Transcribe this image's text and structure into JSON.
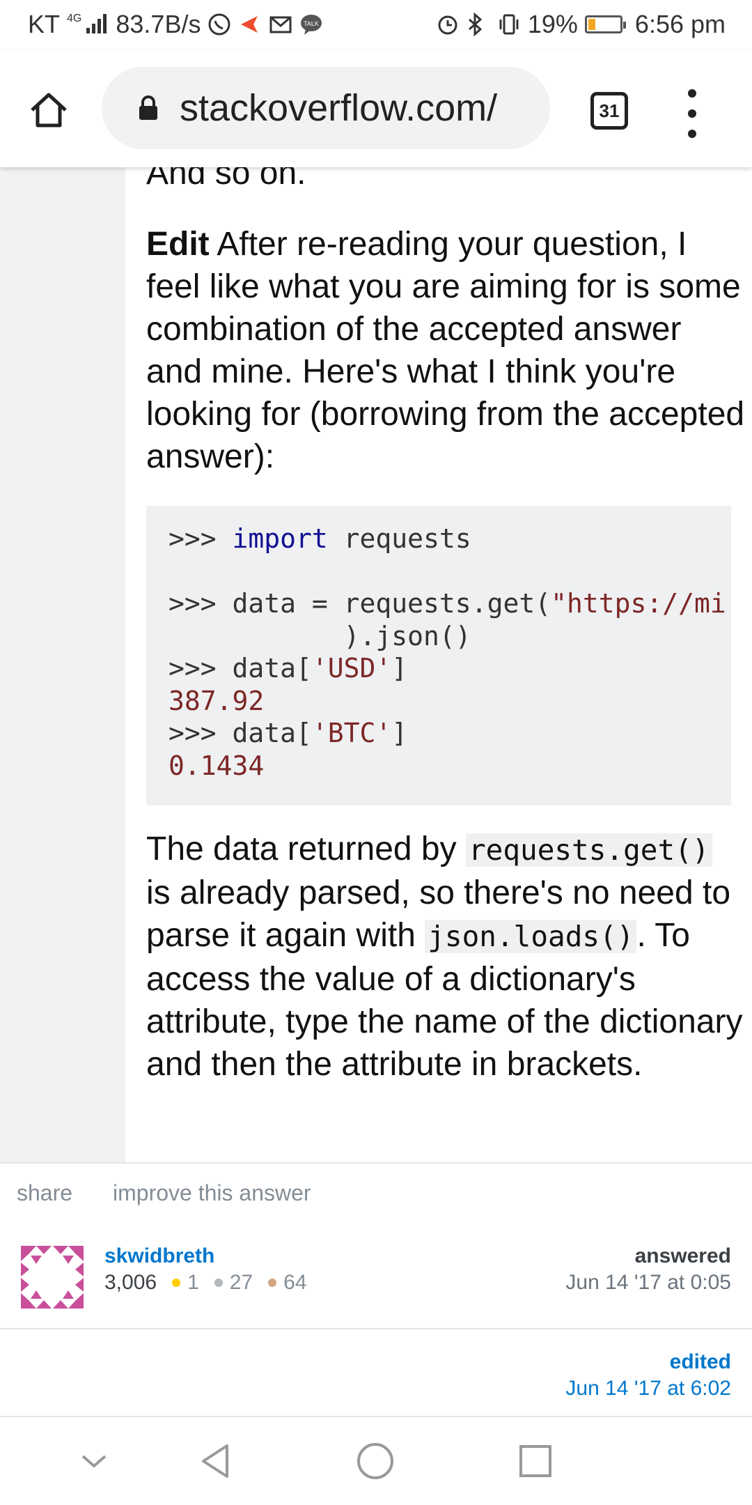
{
  "status_bar": {
    "carrier": "KT",
    "network": "4G",
    "speed": "83.7B/s",
    "battery": "19%",
    "time": "6:56 pm",
    "icons": [
      "whatsapp-icon",
      "shopping-icon",
      "mail-icon",
      "talk-icon",
      "alarm-icon",
      "bluetooth-icon",
      "vibrate-icon",
      "battery-icon"
    ]
  },
  "browser": {
    "url": "stackoverflow.com/",
    "tab_count": "31",
    "icons": [
      "home-icon",
      "lock-icon",
      "tabs-icon",
      "more-icon"
    ]
  },
  "post": {
    "intro_tail": "And so on.",
    "edit_label": "Edit",
    "edit_text": " After re-reading your question, I feel like what you are aiming for is some combination of the accepted answer and mine. Here's what I think you're looking for (borrowing from the accepted answer):",
    "code": {
      "prompt": ">>> ",
      "kw_import": "import",
      "mod": " requests",
      "line2_a": "data = requests.get(",
      "line2_str": "\"https://mi",
      "line3": "           ).json()",
      "line4_a": "data[",
      "line4_str": "'USD'",
      "line4_b": "]",
      "line5": "387.92",
      "line6_a": "data[",
      "line6_str": "'BTC'",
      "line6_b": "]",
      "line7": "0.1434"
    },
    "after_1": "The data returned by ",
    "after_code1": "requests.get()",
    "after_2": " is already parsed, so there's no need to parse it again with ",
    "after_code2": "json.loads()",
    "after_3": ". To access the value of a dictionary's attribute, type the name of the dictionary and then the attribute in brackets."
  },
  "actions": {
    "share": "share",
    "improve": "improve this answer"
  },
  "user": {
    "name": "skwidbreth",
    "reputation": "3,006",
    "gold": "1",
    "silver": "27",
    "bronze": "64",
    "answered_label": "answered",
    "answered_date": "Jun 14 '17 at 0:05"
  },
  "edit_info": {
    "label": "edited",
    "date": "Jun 14 '17 at 6:02"
  },
  "colors": {
    "link": "#0077cc",
    "gold": "#ffcc01",
    "silver": "#b4b8bc",
    "bronze": "#d1a684",
    "avatar": "#c94f9a"
  },
  "nav": [
    "collapse-icon",
    "back-icon",
    "home-circle-icon",
    "recents-icon"
  ]
}
